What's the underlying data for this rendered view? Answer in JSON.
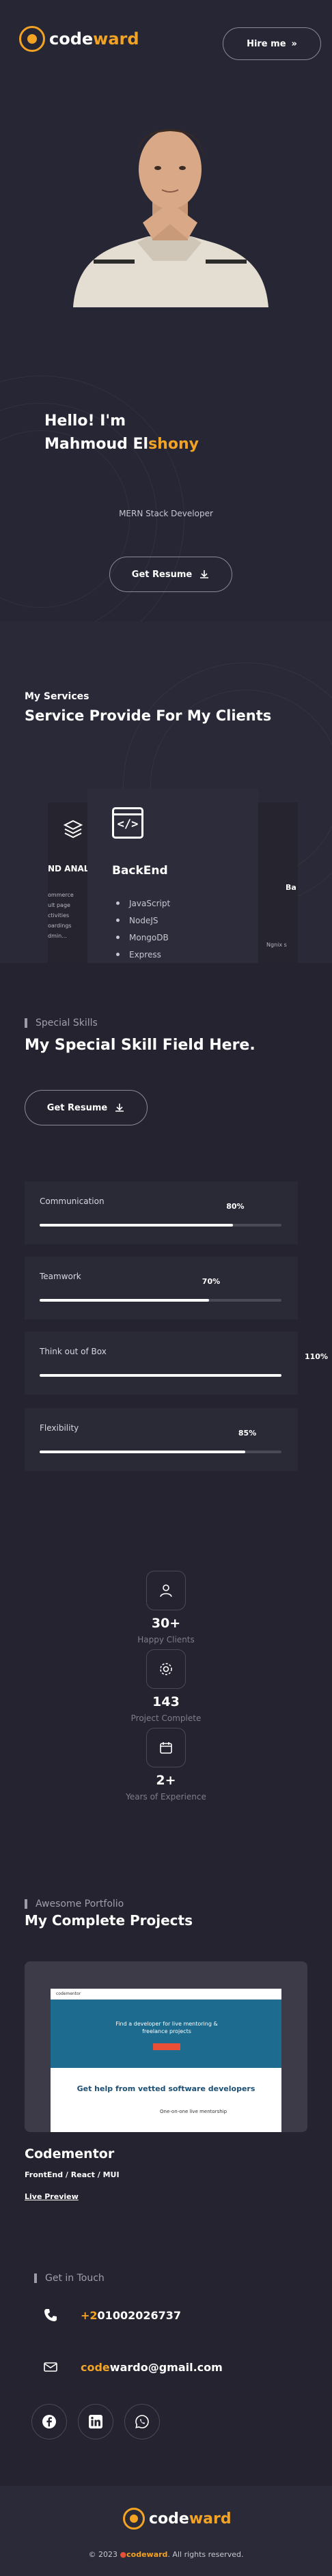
{
  "header": {
    "logo_code": "code",
    "logo_ward": "ward",
    "hire_label": "Hire me",
    "hire_icon": "chevrons-right-icon"
  },
  "hero": {
    "greeting": "Hello! I'm",
    "name_plain": "Mahmoud El",
    "name_accent": "shony",
    "role": "MERN Stack Developer",
    "resume_label": "Get Resume"
  },
  "services": {
    "pretitle": "My Services",
    "title": "Service Provide For My Clients",
    "left_card_title": "ND ANAL",
    "left_card_items": [
      "ommerce",
      "ult page",
      "ctivities",
      "oardings",
      "dmin..."
    ],
    "card": {
      "title": "BackEnd",
      "icon_symbol": "</>",
      "items": [
        "JavaScript",
        "NodeJS",
        "MongoDB",
        "Express"
      ]
    },
    "right_card_title": "Ba",
    "right_card_foot": "Ngnix s"
  },
  "skills": {
    "tag": "Special Skills",
    "title": "My Special Skill Field Here.",
    "resume_label": "Get Resume",
    "items": [
      {
        "label": "Communication",
        "pct_label": "80%",
        "value": 0.8
      },
      {
        "label": "Teamwork",
        "pct_label": "70%",
        "value": 0.7
      },
      {
        "label": "Think out of Box",
        "pct_label": "110%",
        "value": 1.1
      },
      {
        "label": "Flexibility",
        "pct_label": "85%",
        "value": 0.85
      }
    ]
  },
  "stats": [
    {
      "icon": "user-icon",
      "num": "30+",
      "label": "Happy Clients"
    },
    {
      "icon": "gear-icon",
      "num": "143",
      "label": "Project Complete"
    },
    {
      "icon": "calendar-icon",
      "num": "2+",
      "label": "Years of Experience"
    }
  ],
  "portfolio": {
    "tag": "Awesome Portfolio",
    "title": "My Complete Projects",
    "shot_nav": "codementor",
    "shot_hero": "Find a developer for live mentoring & freelance projects",
    "shot_h2": "Get help from vetted software developers",
    "shot_card": "One-on-one live mentorship",
    "project_name": "Codementor",
    "stack": "FrontEnd / React / MUI",
    "live": "Live Preview"
  },
  "contact": {
    "tag": "Get in Touch",
    "phone_prefix": "+2",
    "phone_rest": "01002026737",
    "email_accent": "code",
    "email_rest": "wardo@gmail.com",
    "socials": [
      "facebook-icon",
      "linkedin-icon",
      "whatsapp-icon"
    ]
  },
  "footer": {
    "logo_code": "code",
    "logo_ward": "ward",
    "copy_pre": "© 2023",
    "copy_brand_a": "code",
    "copy_brand_b": "ward",
    "copy_post": ". All rights reserved."
  },
  "colors": {
    "accent": "#f3a323",
    "bg": "#24232f",
    "card": "#2a2936"
  }
}
